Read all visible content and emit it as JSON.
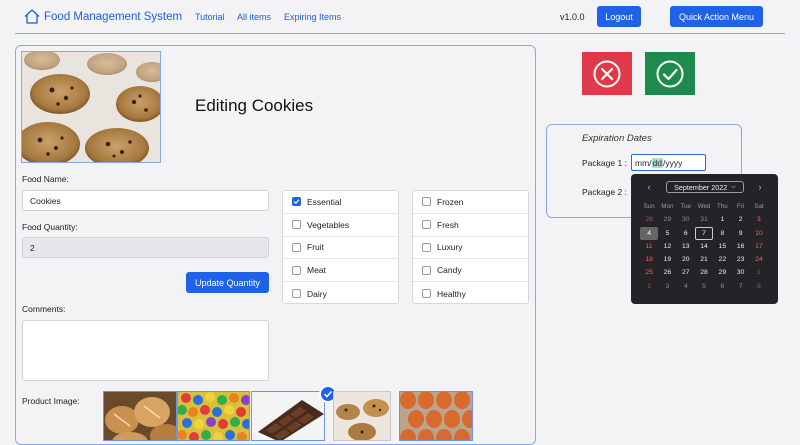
{
  "nav": {
    "brand": "Food Management System",
    "links": [
      "Tutorial",
      "All items",
      "Expiring Items"
    ],
    "version": "v1.0.0",
    "logout": "Logout",
    "quick_action": "Quick Action Menu"
  },
  "editor": {
    "title": "Editing Cookies",
    "food_name_label": "Food Name:",
    "food_name_value": "Cookies",
    "quantity_label": "Food Quantity:",
    "quantity_value": "2",
    "update_quantity": "Update Quantity",
    "comments_label": "Comments:",
    "comments_value": "",
    "product_image_label": "Product Image:"
  },
  "categories_left": [
    {
      "label": "Essential",
      "checked": true
    },
    {
      "label": "Vegetables",
      "checked": false
    },
    {
      "label": "Fruit",
      "checked": false
    },
    {
      "label": "Meat",
      "checked": false
    },
    {
      "label": "Dairy",
      "checked": false
    }
  ],
  "categories_right": [
    {
      "label": "Frozen",
      "checked": false
    },
    {
      "label": "Fresh",
      "checked": false
    },
    {
      "label": "Luxury",
      "checked": false
    },
    {
      "label": "Candy",
      "checked": false
    },
    {
      "label": "Healthy",
      "checked": false
    }
  ],
  "expiration": {
    "title": "Expiration Dates",
    "package1_label": "Package 1 :",
    "package2_label": "Package 2 :",
    "date_mm": "mm",
    "date_dd": "dd",
    "date_yyyy": "yyyy"
  },
  "calendar": {
    "month": "September 2022",
    "weekdays": [
      "Sun",
      "Mon",
      "Tue",
      "Wed",
      "Thu",
      "Fri",
      "Sat"
    ],
    "weeks": [
      [
        "28",
        "29",
        "30",
        "31",
        "1",
        "2",
        "3"
      ],
      [
        "4",
        "5",
        "6",
        "7",
        "8",
        "9",
        "10"
      ],
      [
        "11",
        "12",
        "13",
        "14",
        "15",
        "16",
        "17"
      ],
      [
        "18",
        "19",
        "20",
        "21",
        "22",
        "23",
        "24"
      ],
      [
        "25",
        "26",
        "27",
        "28",
        "29",
        "30",
        "1"
      ],
      [
        "2",
        "3",
        "4",
        "5",
        "6",
        "7",
        "8"
      ]
    ],
    "today": "4",
    "selected": "7"
  },
  "colors": {
    "accent": "#1f62e8",
    "cancel": "#e0394a",
    "confirm": "#1e8a4c"
  }
}
